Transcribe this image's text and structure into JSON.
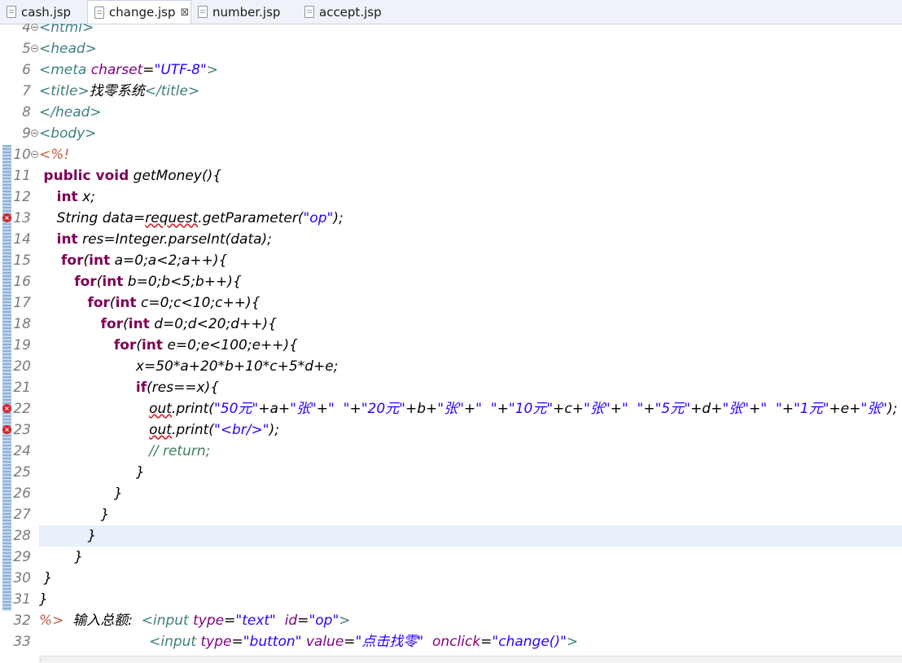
{
  "tabs": [
    {
      "label": "cash.jsp",
      "active": false
    },
    {
      "label": "change.jsp",
      "active": true,
      "close": "⊠"
    },
    {
      "label": "number.jsp",
      "active": false
    },
    {
      "label": "accept.jsp",
      "active": false
    }
  ],
  "lines": [
    {
      "n": "4",
      "fold": true,
      "tokens": [
        {
          "c": "tag",
          "t": "<html>"
        }
      ]
    },
    {
      "n": "5",
      "fold": true,
      "tokens": [
        {
          "c": "tag",
          "t": "<head>"
        }
      ]
    },
    {
      "n": "6",
      "tokens": [
        {
          "c": "tag",
          "t": "<meta "
        },
        {
          "c": "attr",
          "t": "charset"
        },
        {
          "t": "="
        },
        {
          "c": "str",
          "t": "\"UTF-8\""
        },
        {
          "c": "tag",
          "t": ">"
        }
      ]
    },
    {
      "n": "7",
      "tokens": [
        {
          "c": "tag",
          "t": "<title>"
        },
        {
          "t": "找零系统"
        },
        {
          "c": "tag",
          "t": "</title>"
        }
      ]
    },
    {
      "n": "8",
      "tokens": [
        {
          "c": "tag",
          "t": "</head>"
        }
      ]
    },
    {
      "n": "9",
      "fold": true,
      "tokens": [
        {
          "c": "tag",
          "t": "<body>"
        }
      ]
    },
    {
      "n": "10",
      "fold": true,
      "tokens": [
        {
          "c": "jsp",
          "t": "<%!"
        }
      ]
    },
    {
      "n": "11",
      "tokens": [
        {
          "t": " "
        },
        {
          "c": "kw",
          "t": "public void"
        },
        {
          "t": " getMoney(){"
        }
      ]
    },
    {
      "n": "12",
      "tokens": [
        {
          "t": "    "
        },
        {
          "c": "kw",
          "t": "int"
        },
        {
          "t": " x;"
        }
      ]
    },
    {
      "n": "13",
      "error": true,
      "tokens": [
        {
          "t": "    String data="
        },
        {
          "c": "squig",
          "t": "request"
        },
        {
          "t": ".getParameter("
        },
        {
          "c": "str",
          "t": "\"op\""
        },
        {
          "t": ");"
        }
      ]
    },
    {
      "n": "14",
      "tokens": [
        {
          "t": "    "
        },
        {
          "c": "kw",
          "t": "int"
        },
        {
          "t": " res=Integer.parseInt(data);"
        }
      ]
    },
    {
      "n": "15",
      "tokens": [
        {
          "t": "     "
        },
        {
          "c": "kw",
          "t": "for"
        },
        {
          "t": "("
        },
        {
          "c": "kw",
          "t": "int"
        },
        {
          "t": " a=0;a<2;a++){"
        }
      ]
    },
    {
      "n": "16",
      "tokens": [
        {
          "t": "        "
        },
        {
          "c": "kw",
          "t": "for"
        },
        {
          "t": "("
        },
        {
          "c": "kw",
          "t": "int"
        },
        {
          "t": " b=0;b<5;b++){"
        }
      ]
    },
    {
      "n": "17",
      "tokens": [
        {
          "t": "           "
        },
        {
          "c": "kw",
          "t": "for"
        },
        {
          "t": "("
        },
        {
          "c": "kw",
          "t": "int"
        },
        {
          "t": " c=0;c<10;c++){"
        }
      ]
    },
    {
      "n": "18",
      "tokens": [
        {
          "t": "              "
        },
        {
          "c": "kw",
          "t": "for"
        },
        {
          "t": "("
        },
        {
          "c": "kw",
          "t": "int"
        },
        {
          "t": " d=0;d<20;d++){"
        }
      ]
    },
    {
      "n": "19",
      "tokens": [
        {
          "t": "                 "
        },
        {
          "c": "kw",
          "t": "for"
        },
        {
          "t": "("
        },
        {
          "c": "kw",
          "t": "int"
        },
        {
          "t": " e=0;e<100;e++){"
        }
      ]
    },
    {
      "n": "20",
      "tokens": [
        {
          "t": "                      x=50*a+20*b+10*c+5*d+e;"
        }
      ]
    },
    {
      "n": "21",
      "tokens": [
        {
          "t": "                      "
        },
        {
          "c": "kw",
          "t": "if"
        },
        {
          "t": "(res==x){"
        }
      ]
    },
    {
      "n": "22",
      "error": true,
      "tokens": [
        {
          "t": "                         "
        },
        {
          "c": "squig",
          "t": "out"
        },
        {
          "t": ".print("
        },
        {
          "c": "str",
          "t": "\"50元\""
        },
        {
          "t": "+a+"
        },
        {
          "c": "str",
          "t": "\"张\""
        },
        {
          "t": "+"
        },
        {
          "c": "str",
          "t": "\"  \""
        },
        {
          "t": "+"
        },
        {
          "c": "str",
          "t": "\"20元\""
        },
        {
          "t": "+b+"
        },
        {
          "c": "str",
          "t": "\"张\""
        },
        {
          "t": "+"
        },
        {
          "c": "str",
          "t": "\"  \""
        },
        {
          "t": "+"
        },
        {
          "c": "str",
          "t": "\"10元\""
        },
        {
          "t": "+c+"
        },
        {
          "c": "str",
          "t": "\"张\""
        },
        {
          "t": "+"
        },
        {
          "c": "str",
          "t": "\"  \""
        },
        {
          "t": "+"
        },
        {
          "c": "str",
          "t": "\"5元\""
        },
        {
          "t": "+d+"
        },
        {
          "c": "str",
          "t": "\"张\""
        },
        {
          "t": "+"
        },
        {
          "c": "str",
          "t": "\"  \""
        },
        {
          "t": "+"
        },
        {
          "c": "str",
          "t": "\"1元\""
        },
        {
          "t": "+e+"
        },
        {
          "c": "str",
          "t": "\"张\""
        },
        {
          "t": ");"
        }
      ]
    },
    {
      "n": "23",
      "error": true,
      "tokens": [
        {
          "t": "                         "
        },
        {
          "c": "squig",
          "t": "out"
        },
        {
          "t": ".print("
        },
        {
          "c": "str",
          "t": "\"<br/>\""
        },
        {
          "t": ");"
        }
      ]
    },
    {
      "n": "24",
      "tokens": [
        {
          "t": "                         "
        },
        {
          "c": "cmt",
          "t": "// return;"
        }
      ]
    },
    {
      "n": "25",
      "tokens": [
        {
          "t": "                      }"
        }
      ]
    },
    {
      "n": "26",
      "tokens": [
        {
          "t": "                 }"
        }
      ]
    },
    {
      "n": "27",
      "tokens": [
        {
          "t": "              }"
        }
      ]
    },
    {
      "n": "28",
      "current": true,
      "tokens": [
        {
          "t": "           }"
        }
      ]
    },
    {
      "n": "29",
      "tokens": [
        {
          "t": "        }"
        }
      ]
    },
    {
      "n": "30",
      "tokens": [
        {
          "t": " }"
        }
      ]
    },
    {
      "n": "31",
      "tokens": [
        {
          "t": "}"
        }
      ]
    },
    {
      "n": "32",
      "tokens": [
        {
          "c": "jsp",
          "t": "%>"
        },
        {
          "t": "  输入总额:  "
        },
        {
          "c": "tag",
          "t": "<input "
        },
        {
          "c": "attr",
          "t": "type"
        },
        {
          "t": "="
        },
        {
          "c": "str",
          "t": "\"text\""
        },
        {
          "t": "  "
        },
        {
          "c": "attr",
          "t": "id"
        },
        {
          "t": "="
        },
        {
          "c": "str",
          "t": "\"op\""
        },
        {
          "c": "tag",
          "t": ">"
        }
      ]
    },
    {
      "n": "33",
      "tokens": [
        {
          "t": "                         "
        },
        {
          "c": "tag",
          "t": "<input "
        },
        {
          "c": "attr",
          "t": "type"
        },
        {
          "t": "="
        },
        {
          "c": "str",
          "t": "\"button\""
        },
        {
          "t": " "
        },
        {
          "c": "attr",
          "t": "value"
        },
        {
          "t": "="
        },
        {
          "c": "str",
          "t": "\"点击找零\""
        },
        {
          "t": "  "
        },
        {
          "c": "attr",
          "t": "onclick"
        },
        {
          "t": "="
        },
        {
          "c": "str",
          "t": "\"change()\""
        },
        {
          "c": "tag",
          "t": ">"
        }
      ]
    }
  ],
  "colors": {
    "tag": "#3f7f7f",
    "attribute": "#7f007f",
    "string": "#2a00ff",
    "keyword": "#7f0055",
    "comment": "#3f7f5f",
    "jsp": "#bf5f3f",
    "error": "#d4262c",
    "current_line": "#e9f0fb"
  }
}
